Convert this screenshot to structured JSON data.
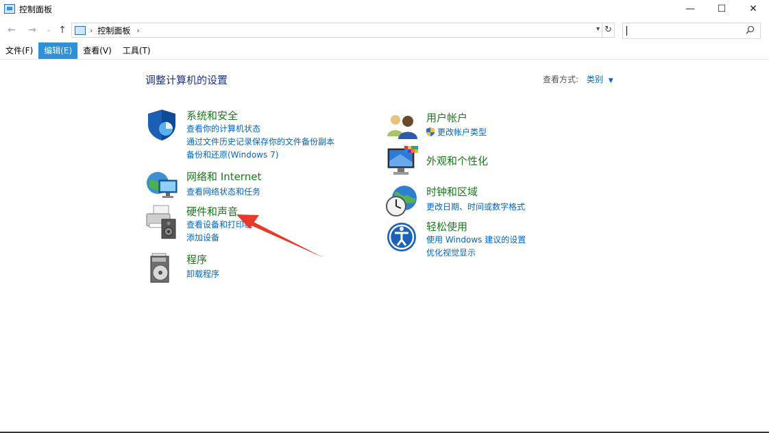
{
  "window": {
    "title": "控制面板",
    "minimize_glyph": "—",
    "maximize_glyph": "☐",
    "close_glyph": "✕"
  },
  "navigation": {
    "back_icon": "arrow-left-icon",
    "forward_icon": "arrow-right-icon",
    "recent_icon": "chevron-down-icon",
    "up_icon": "arrow-up-icon",
    "breadcrumb": "控制面板",
    "search_placeholder": ""
  },
  "menu": {
    "items": [
      {
        "label": "文件(F)",
        "active": false
      },
      {
        "label": "编辑(E)",
        "active": true
      },
      {
        "label": "查看(V)",
        "active": false
      },
      {
        "label": "工具(T)",
        "active": false
      }
    ]
  },
  "content": {
    "heading": "调整计算机的设置",
    "view_by_label": "查看方式:",
    "view_by_value": "类别"
  },
  "categories": {
    "system_security": {
      "title": "系统和安全",
      "icon": "shield-icon",
      "links": [
        "查看你的计算机状态",
        "通过文件历史记录保存你的文件备份副本",
        "备份和还原(Windows 7)"
      ]
    },
    "network": {
      "title": "网络和 Internet",
      "icon": "globe-network-icon",
      "links": [
        "查看网络状态和任务"
      ]
    },
    "hardware": {
      "title": "硬件和声音",
      "icon": "printer-speaker-icon",
      "links": [
        "查看设备和打印机",
        "添加设备"
      ]
    },
    "programs": {
      "title": "程序",
      "icon": "programs-disc-icon",
      "links": [
        "卸载程序"
      ]
    },
    "user_accounts": {
      "title": "用户帐户",
      "icon": "users-icon",
      "links": [
        "更改帐户类型"
      ]
    },
    "appearance": {
      "title": "外观和个性化",
      "icon": "monitor-palette-icon",
      "links": []
    },
    "clock_region": {
      "title": "时钟和区域",
      "icon": "clock-globe-icon",
      "links": [
        "更改日期、时间或数字格式"
      ]
    },
    "ease_access": {
      "title": "轻松使用",
      "icon": "ease-of-access-icon",
      "links": [
        "使用 Windows 建议的设置",
        "优化视觉显示"
      ]
    }
  },
  "colors": {
    "heading": "#1e3287",
    "category_title": "#197a19",
    "link": "#0066cc",
    "menu_active": "#2f8fd8",
    "annotation_arrow": "#e8392b"
  }
}
